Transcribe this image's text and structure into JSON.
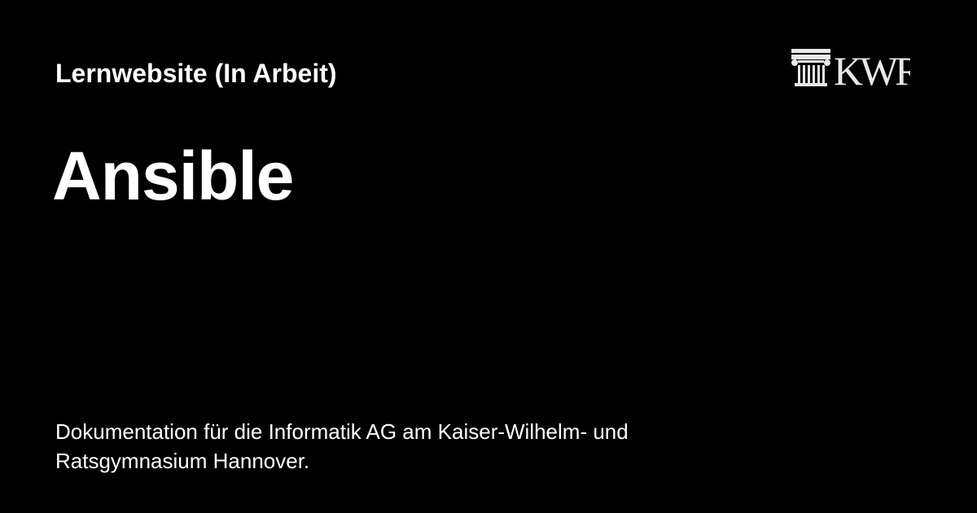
{
  "card": {
    "background": "#000000",
    "text_color": "#ffffff",
    "site_name": "Lernwebsite (In Arbeit)",
    "page_title": "Ansible",
    "description": "Dokumentation für die Informatik AG am Kaiser-Wilhelm- und Ratsgymnasium Hannover."
  },
  "logo": {
    "icon": "column-capital-icon",
    "color": "#e8e8e8",
    "text": "KWR"
  }
}
